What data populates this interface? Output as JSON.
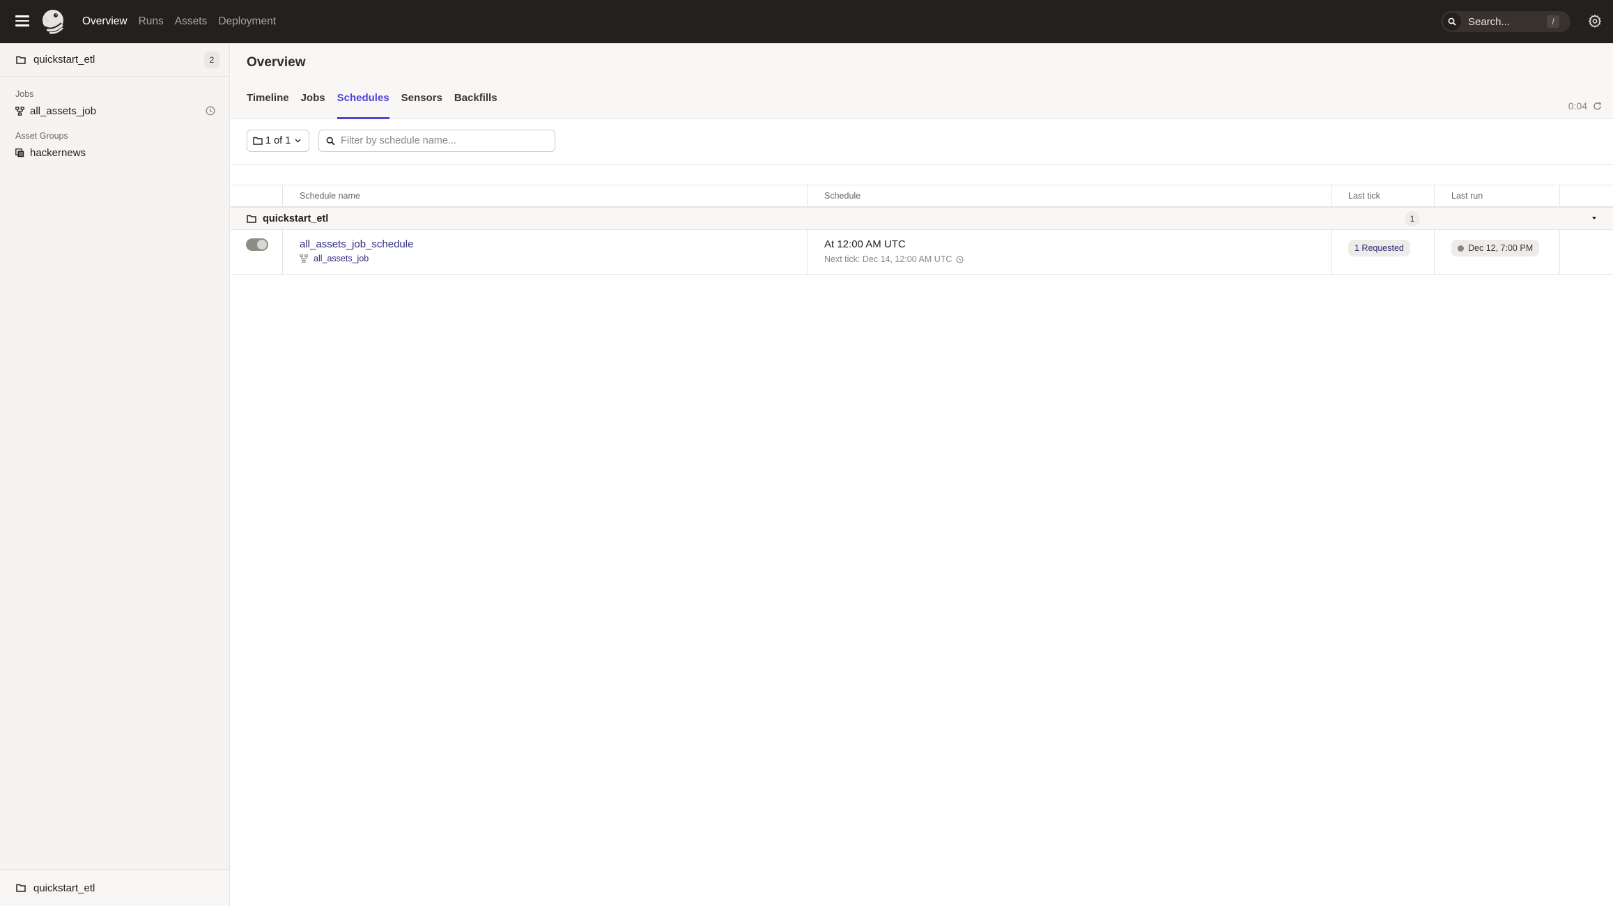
{
  "topnav": {
    "items": [
      {
        "label": "Overview",
        "active": true
      },
      {
        "label": "Runs",
        "active": false
      },
      {
        "label": "Assets",
        "active": false
      },
      {
        "label": "Deployment",
        "active": false
      }
    ],
    "search_placeholder": "Search...",
    "search_shortcut": "/"
  },
  "sidebar": {
    "repo_name": "quickstart_etl",
    "repo_count": "2",
    "jobs_label": "Jobs",
    "jobs": [
      {
        "label": "all_assets_job"
      }
    ],
    "asset_groups_label": "Asset Groups",
    "asset_groups": [
      {
        "label": "hackernews"
      }
    ],
    "footer_repo": "quickstart_etl"
  },
  "page": {
    "title": "Overview",
    "tabs": [
      {
        "label": "Timeline",
        "active": false
      },
      {
        "label": "Jobs",
        "active": false
      },
      {
        "label": "Schedules",
        "active": true
      },
      {
        "label": "Sensors",
        "active": false
      },
      {
        "label": "Backfills",
        "active": false
      }
    ],
    "refresh_timer": "0:04",
    "accent_color": "#4f43dd"
  },
  "filters": {
    "repo_select": "1 of 1",
    "search_placeholder": "Filter by schedule name...",
    "search_value": ""
  },
  "table": {
    "columns": [
      "",
      "Schedule name",
      "Schedule",
      "Last tick",
      "Last run",
      ""
    ],
    "groups": [
      {
        "name": "quickstart_etl",
        "count": "1",
        "rows": [
          {
            "toggle_on": false,
            "schedule_name": "all_assets_job_schedule",
            "job": "all_assets_job",
            "schedule": "At 12:00 AM UTC",
            "next_tick": "Next tick: Dec 14, 12:00 AM UTC",
            "last_tick": "1 Requested",
            "last_run": "Dec 12, 7:00 PM"
          }
        ]
      }
    ]
  }
}
